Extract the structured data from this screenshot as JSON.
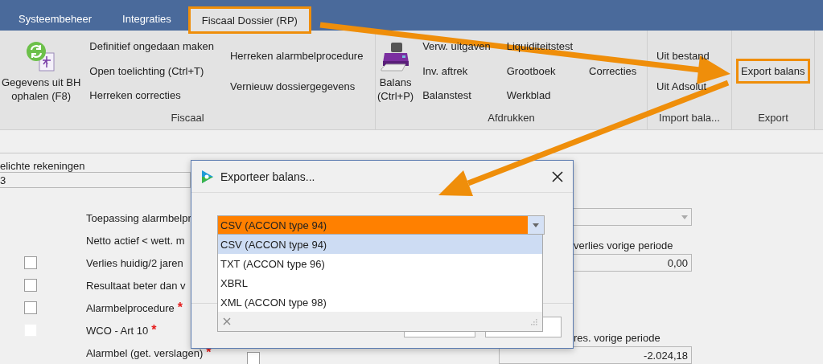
{
  "tabs": [
    {
      "label": "Systeembeheer",
      "selected": false,
      "highlighted": false
    },
    {
      "label": "Integraties",
      "selected": false,
      "highlighted": false
    },
    {
      "label": "Fiscaal Dossier (RP)",
      "selected": true,
      "highlighted": true
    }
  ],
  "ribbon": {
    "groups": [
      {
        "label": "Fiscaal",
        "large_button": {
          "kind": "refresh",
          "label": "Gegevens uit BH\nophalen (F8)"
        },
        "columns": [
          [
            {
              "label": "Definitief ongedaan maken",
              "highlighted": false
            },
            {
              "label": "Open toelichting (Ctrl+T)",
              "highlighted": false
            },
            {
              "label": "Herreken correcties",
              "highlighted": false
            }
          ],
          [
            {
              "label": "Herreken alarmbelprocedure",
              "highlighted": false
            },
            {
              "label": "Vernieuw dossiergegevens",
              "highlighted": false
            }
          ]
        ]
      },
      {
        "label": "Afdrukken",
        "large_button": {
          "kind": "printer",
          "label": "Balans\n(Ctrl+P)"
        },
        "columns": [
          [
            {
              "label": "Verw. uitgaven",
              "highlighted": false
            },
            {
              "label": "Inv. aftrek",
              "highlighted": false
            },
            {
              "label": "Balanstest",
              "highlighted": false
            }
          ],
          [
            {
              "label": "Liquiditeitstest",
              "highlighted": false
            },
            {
              "label": "Grootboek",
              "highlighted": false
            },
            {
              "label": "Werkblad",
              "highlighted": false
            }
          ],
          [
            {
              "label": "Correcties",
              "highlighted": false
            }
          ]
        ]
      },
      {
        "label": "Import bala...",
        "columns": [
          [
            {
              "label": "Uit bestand",
              "highlighted": false
            },
            {
              "label": "Uit Adsolut",
              "highlighted": false
            }
          ]
        ]
      },
      {
        "label": "Export",
        "columns": [
          [
            {
              "label": "Export balans",
              "highlighted": true
            }
          ]
        ]
      }
    ]
  },
  "form": {
    "account_field": {
      "label": "elichte rekeningen",
      "value": "3"
    },
    "rows": [
      {
        "kind": "plain",
        "label": "Toepassing alarmbelpr"
      },
      {
        "kind": "plain",
        "label": "Netto actief < wett. m"
      },
      {
        "kind": "checkbox",
        "label": "Verlies huidig/2 jaren",
        "checked": false,
        "disabled": false
      },
      {
        "kind": "checkbox",
        "label": "Resultaat beter dan v",
        "checked": false,
        "disabled": false
      },
      {
        "kind": "checkbox",
        "label": "Alarmbelprocedure",
        "required_mark": "*",
        "checked": false,
        "disabled": false
      },
      {
        "kind": "checkbox",
        "label": "WCO - Art 10",
        "required_mark": "*",
        "checked": false,
        "disabled": true
      },
      {
        "kind": "trailing",
        "label": "Alarmbel (get. verslagen)",
        "required_mark": "*",
        "checked": false,
        "disabled": false
      }
    ],
    "right_fields": [
      {
        "kind": "select"
      },
      {
        "kind": "number",
        "label": "verlies vorige periode",
        "value": "0,00"
      },
      {
        "kind": "number",
        "label": "res. vorige periode",
        "value": "-2.024,18"
      }
    ]
  },
  "dialog": {
    "title": "Exporteer balans...",
    "format": {
      "value": "CSV (ACCON type 94)",
      "options": [
        {
          "label": "CSV (ACCON type 94)",
          "selected": true
        },
        {
          "label": "TXT (ACCON type 96)",
          "selected": false
        },
        {
          "label": "XBRL",
          "selected": false
        },
        {
          "label": "XML (ACCON type 98)",
          "selected": false
        }
      ]
    }
  }
}
